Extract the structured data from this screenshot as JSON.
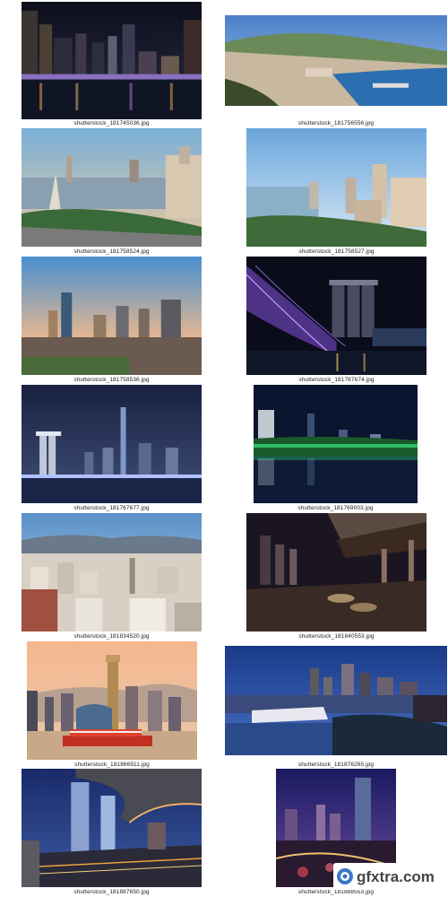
{
  "captions": [
    "shutterstock_181745036.jpg",
    "shutterstock_181756556.jpg",
    "shutterstock_181758524.jpg",
    "shutterstock_181758527.jpg",
    "shutterstock_181758536.jpg",
    "shutterstock_181767674.jpg",
    "shutterstock_181767677.jpg",
    "shutterstock_181769003.jpg",
    "shutterstock_181834520.jpg",
    "shutterstock_181840553.jpg",
    "shutterstock_181866911.jpg",
    "shutterstock_181876265.jpg",
    "shutterstock_181887650.jpg",
    "shutterstock_181888553.jpg"
  ],
  "watermark": {
    "text": "gfxtra.com",
    "icon": "gfxtra-logo-icon"
  }
}
